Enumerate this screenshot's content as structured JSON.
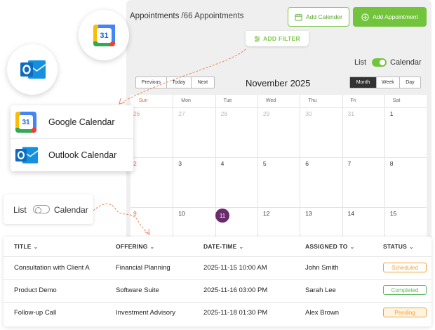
{
  "header": {
    "title": "Appointments",
    "count_label": "/66 Appointments",
    "add_calendar_label": "Add Calender",
    "add_appointment_label": "Add Appointment",
    "add_filter_label": "ADD FILTER"
  },
  "view_toggle": {
    "list_label": "List",
    "calendar_label": "Calendar",
    "calendar_on": true
  },
  "nav": {
    "previous": "Previous",
    "today": "Today",
    "next": "Next"
  },
  "month_title": "November 2025",
  "views": {
    "month": "Month",
    "week": "Week",
    "day": "Day",
    "active": "month"
  },
  "weekdays": [
    "Sun",
    "Mon",
    "Tue",
    "Wed",
    "Thu",
    "Fri",
    "Sat"
  ],
  "weeks": [
    [
      "26",
      "27",
      "28",
      "29",
      "30",
      "31",
      "1"
    ],
    [
      "2",
      "3",
      "4",
      "5",
      "6",
      "7",
      "8"
    ],
    [
      "9",
      "10",
      "11",
      "12",
      "13",
      "14",
      "15"
    ]
  ],
  "today_day": "11",
  "icons": {
    "google": "google-calendar-icon",
    "outlook": "outlook-icon"
  },
  "google_tile_number": "31",
  "dropdown": {
    "items": [
      {
        "label": "Google Calendar",
        "icon": "google-calendar-icon"
      },
      {
        "label": "Outlook Calendar",
        "icon": "outlook-icon"
      }
    ]
  },
  "list_toggle": {
    "list_label": "List",
    "calendar_label": "Calendar",
    "calendar_on": false
  },
  "table": {
    "columns": [
      "TITLE",
      "OFFERING",
      "DATE-TIME",
      "ASSIGNED TO",
      "STATUS"
    ],
    "rows": [
      {
        "title": "Consultation with Client A",
        "offering": "Financial Planning",
        "datetime": "2025-11-15 10:00 AM",
        "assigned": "John Smith",
        "status": "Scheduled"
      },
      {
        "title": "Product Demo",
        "offering": "Software Suite",
        "datetime": "2025-11-16 03:00 PM",
        "assigned": "Sarah Lee",
        "status": "Completed"
      },
      {
        "title": "Follow-up Call",
        "offering": "Investment Advisory",
        "datetime": "2025-11-18 01:30 PM",
        "assigned": "Alex Brown",
        "status": "Pending"
      }
    ]
  },
  "colors": {
    "accent_green": "#72c43c",
    "today_purple": "#6b2a6e",
    "scheduled": "#f0a23a",
    "completed": "#5cb85c",
    "pending": "#f0a23a",
    "pending_bg": "#fff4e0",
    "sunday_red": "#e0643a",
    "google_blue": "#4285f4",
    "outlook_blue": "#0f6cbd"
  }
}
